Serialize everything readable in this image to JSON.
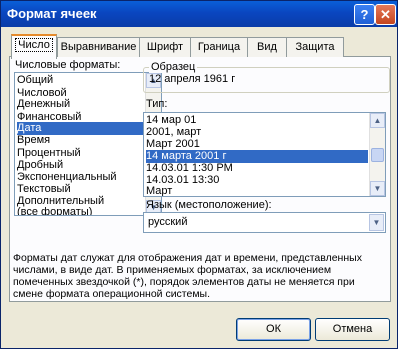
{
  "window": {
    "title": "Формат ячеек",
    "help_label": "?",
    "close_label": "✕"
  },
  "tabs": [
    {
      "label": "Число",
      "active": true
    },
    {
      "label": "Выравнивание",
      "active": false
    },
    {
      "label": "Шрифт",
      "active": false
    },
    {
      "label": "Граница",
      "active": false
    },
    {
      "label": "Вид",
      "active": false
    },
    {
      "label": "Защита",
      "active": false
    }
  ],
  "categories": {
    "label": "Числовые форматы:",
    "items": [
      "Общий",
      "Числовой",
      "Денежный",
      "Финансовый",
      "Дата",
      "Время",
      "Процентный",
      "Дробный",
      "Экспоненциальный",
      "Текстовый",
      "Дополнительный",
      "(все форматы)"
    ],
    "selected": "Дата"
  },
  "sample": {
    "label": "Образец",
    "value": "12 апреля 1961 г"
  },
  "type": {
    "label": "Тип:",
    "items": [
      "14 мар 01",
      "2001, март",
      "Март 2001",
      "14 марта 2001 г",
      "14.03.01 1:30 PM",
      "14.03.01 13:30",
      "Март"
    ],
    "selected": "14 марта 2001 г"
  },
  "locale": {
    "label": "Язык (местоположение):",
    "value": "русский"
  },
  "description": "Форматы дат служат для отображения дат и времени, представленных числами, в виде дат. В применяемых форматах, за исключением помеченных звездочкой (*), порядок элементов даты не меняется при смене формата операционной системы.",
  "buttons": {
    "ok": "ОК",
    "cancel": "Отмена"
  },
  "colors": {
    "selection": "#316ac5",
    "titlebar": "#0a46c0",
    "active_tab_accent": "#e68b2c"
  }
}
